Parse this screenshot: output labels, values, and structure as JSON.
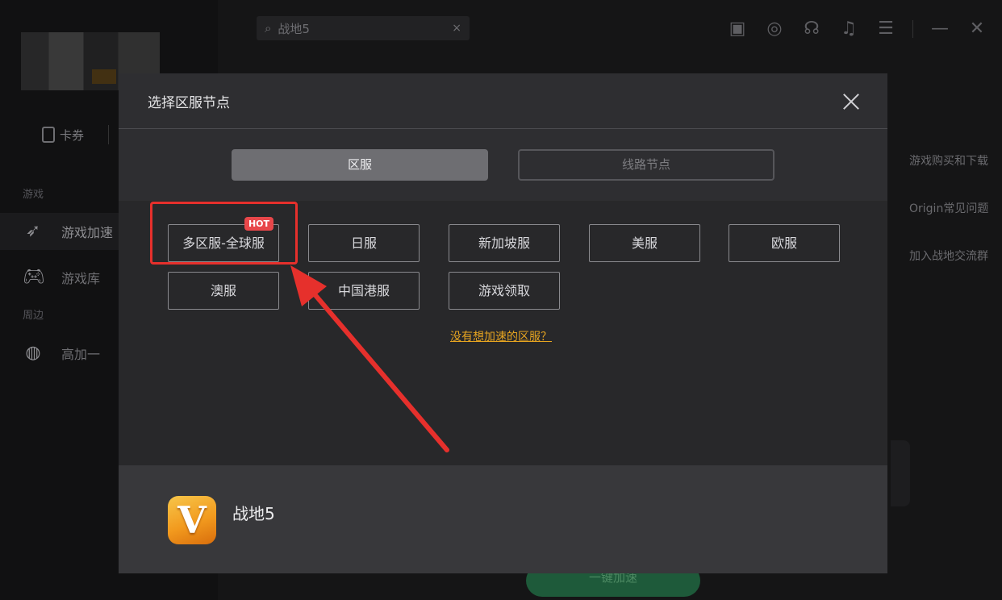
{
  "app": {
    "search": {
      "value": "战地5",
      "clear_glyph": "×"
    },
    "sidebar": {
      "coupon_label": "卡券",
      "section_games": "游戏",
      "section_nearby": "周边",
      "items": [
        {
          "label": "游戏加速",
          "icon": "rocket-icon"
        },
        {
          "label": "游戏库",
          "icon": "gamepad-icon"
        },
        {
          "label": "高加一",
          "icon": "bag-icon"
        }
      ]
    },
    "right_links": [
      "游戏购买和下载",
      "Origin常见问题",
      "加入战地交流群"
    ],
    "accelerate_button": "一键加速"
  },
  "modal": {
    "title": "选择区服节点",
    "tabs": {
      "active": "区服",
      "inactive": "线路节点"
    },
    "regions": {
      "row1": [
        "多区服-全球服",
        "日服",
        "新加坡服",
        "美服",
        "欧服"
      ],
      "row2": [
        "澳服",
        "中国港服",
        "游戏领取"
      ]
    },
    "hot_badge": "HOT",
    "missing_link": "没有想加速的区服？",
    "game": {
      "name": "战地5",
      "icon_letter": "V"
    }
  },
  "colors": {
    "highlight": "#e6302c",
    "link": "#e6a420",
    "hot": "#e8474a",
    "game_icon": "#f29a1e"
  }
}
